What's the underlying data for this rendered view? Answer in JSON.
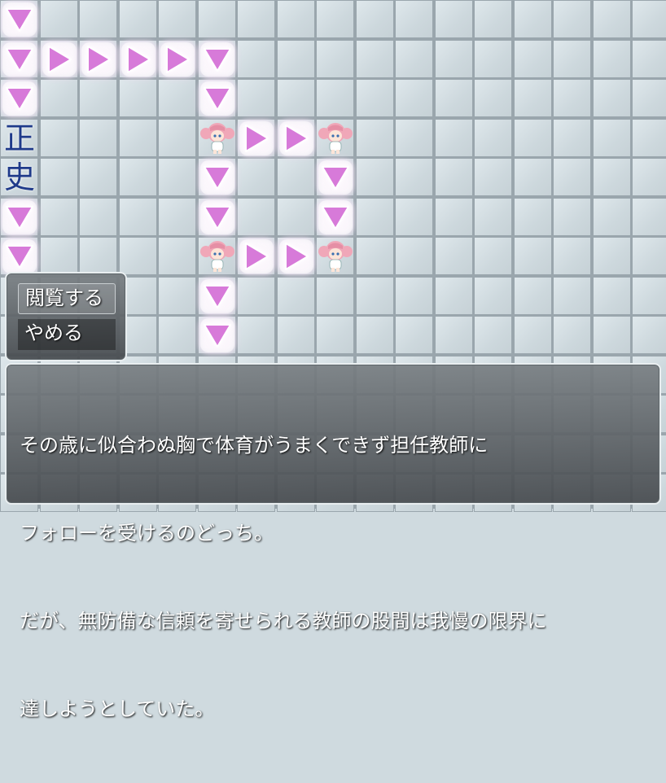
{
  "map": {
    "kanji_top": "正",
    "kanji_bottom": "史"
  },
  "choices": {
    "view_label": "閲覧する",
    "stop_label": "やめる"
  },
  "message": {
    "lines": [
      "その歳に似合わぬ胸で体育がうまくできず担任教師に",
      "フォローを受けるのどっち。",
      "だが、無防備な信頼を寄せられる教師の股間は我慢の限界に",
      "達しようとしていた。"
    ]
  },
  "colors": {
    "arrow": "#d77ad9",
    "kanji": "#1f3a8a",
    "hair": "#f0a7b8"
  },
  "icons": [
    "arrow-down-icon",
    "arrow-right-icon",
    "character-sprite"
  ]
}
